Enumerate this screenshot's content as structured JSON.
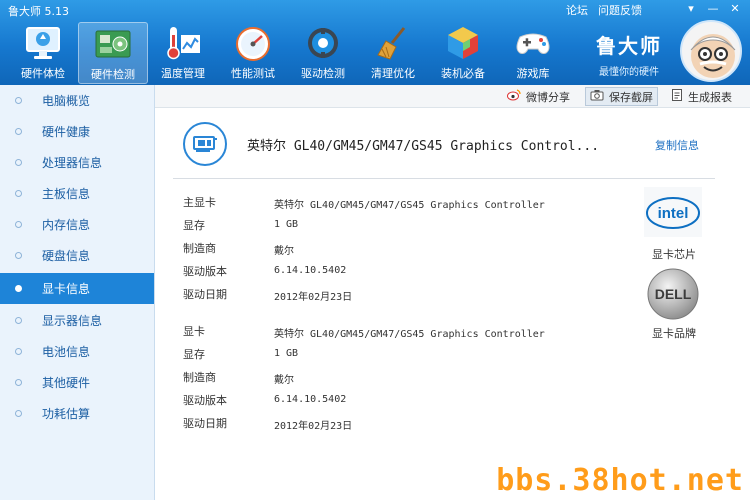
{
  "window": {
    "title": "鲁大师 5.13",
    "links": [
      "论坛",
      "问题反馈"
    ],
    "controls": [
      "▾",
      "—",
      "✕"
    ]
  },
  "nav": [
    {
      "label": "硬件体检",
      "icon": "monitor-icon"
    },
    {
      "label": "硬件检测",
      "icon": "circuit-board-icon"
    },
    {
      "label": "温度管理",
      "icon": "thermometer-icon"
    },
    {
      "label": "性能测试",
      "icon": "speedometer-icon"
    },
    {
      "label": "驱动检测",
      "icon": "gear-icon"
    },
    {
      "label": "清理优化",
      "icon": "broom-icon"
    },
    {
      "label": "装机必备",
      "icon": "cube-icon"
    },
    {
      "label": "游戏库",
      "icon": "gamepad-icon"
    }
  ],
  "nav_active_index": 1,
  "brand": {
    "name": "鲁大师",
    "slogan": "最懂你的硬件"
  },
  "toolbar": {
    "weibo": "微博分享",
    "screenshot": "保存截屏",
    "report": "生成报表"
  },
  "sidebar": {
    "items": [
      "电脑概览",
      "硬件健康",
      "处理器信息",
      "主板信息",
      "内存信息",
      "硬盘信息",
      "显卡信息",
      "显示器信息",
      "电池信息",
      "其他硬件",
      "功耗估算"
    ],
    "active_index": 6
  },
  "device": {
    "title": "英特尔 GL40/GM45/GM47/GS45 Graphics Control...",
    "copy_label": "复制信息"
  },
  "sections": [
    {
      "rows": [
        {
          "label": "主显卡",
          "value": "英特尔 GL40/GM45/GM47/GS45 Graphics Controller"
        },
        {
          "label": "显存",
          "value": "1 GB"
        },
        {
          "label": "制造商",
          "value": "戴尔"
        },
        {
          "label": "驱动版本",
          "value": "6.14.10.5402"
        },
        {
          "label": "驱动日期",
          "value": "2012年02月23日"
        }
      ]
    },
    {
      "rows": [
        {
          "label": "显卡",
          "value": "英特尔 GL40/GM45/GM47/GS45 Graphics Controller"
        },
        {
          "label": "显存",
          "value": "1 GB"
        },
        {
          "label": "制造商",
          "value": "戴尔"
        },
        {
          "label": "驱动版本",
          "value": "6.14.10.5402"
        },
        {
          "label": "驱动日期",
          "value": "2012年02月23日"
        }
      ]
    }
  ],
  "logos": [
    {
      "name": "intel-logo",
      "caption": "显卡芯片",
      "mark_text": "intel"
    },
    {
      "name": "dell-logo",
      "caption": "显卡品牌",
      "mark_text": "DELL"
    }
  ],
  "watermark": "bbs.38hot.net",
  "colors": {
    "header": "#1678cf",
    "sidebar_bg": "#eaf3fc",
    "active": "#1e84d8",
    "link": "#1c6fc2",
    "watermark": "#ff9c1a"
  }
}
